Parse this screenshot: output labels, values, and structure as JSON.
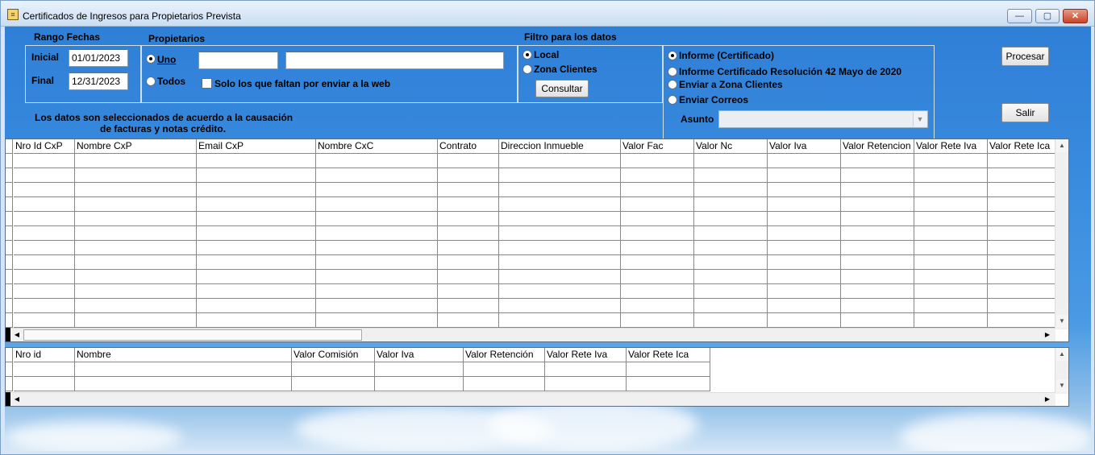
{
  "window": {
    "title": "Certificados de Ingresos para Propietarios Prevista"
  },
  "titlebar_buttons": {
    "minimize": "—",
    "maximize": "▢",
    "close": "✕"
  },
  "rango_fechas": {
    "legend": "Rango Fechas",
    "inicial_label": "Inicial",
    "inicial_value": "01/01/2023",
    "final_label": "Final",
    "final_value": "12/31/2023"
  },
  "propietarios": {
    "legend": "Propietarios",
    "uno_label": "Uno",
    "todos_label": "Todos",
    "id_value": "",
    "name_value": "",
    "solo_faltan_label": "Solo los que faltan  por enviar a la web"
  },
  "filtro": {
    "legend": "Filtro para los datos",
    "local_label": "Local",
    "zona_label": "Zona Clientes",
    "consultar_label": "Consultar"
  },
  "informe": {
    "opt1": "Informe (Certificado)",
    "opt2": "Informe Certificado Resolución 42 Mayo de 2020",
    "opt3": "Enviar a Zona Clientes",
    "opt4": "Enviar Correos",
    "asunto_label": "Asunto",
    "asunto_value": ""
  },
  "actions": {
    "procesar": "Procesar",
    "salir": "Salir"
  },
  "note": {
    "line1": "Los datos son seleccionados de acuerdo a la causación",
    "line2": "de facturas y notas crédito."
  },
  "grid1": {
    "columns": [
      "Nro Id CxP",
      "Nombre CxP",
      "Email CxP",
      "Nombre CxC",
      "Contrato",
      "Direccion Inmueble",
      "Valor Fac",
      "Valor Nc",
      "Valor Iva",
      "Valor Retencion",
      "Valor Rete Iva",
      "Valor Rete Ica"
    ]
  },
  "grid2": {
    "columns": [
      "Nro id",
      "Nombre",
      "Valor Comisión",
      "Valor Iva",
      "Valor Retención",
      "Valor Rete Iva",
      "Valor Rete Ica"
    ]
  },
  "colors": {
    "accent": "#3b8de0",
    "window_frame": "#d6e6f6"
  }
}
